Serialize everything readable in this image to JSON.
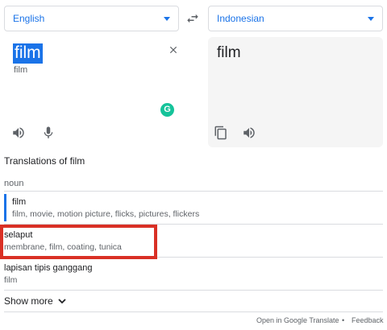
{
  "languages": {
    "source": "English",
    "target": "Indonesian"
  },
  "source": {
    "text": "film",
    "transliteration": "film"
  },
  "target": {
    "text": "film"
  },
  "translations": {
    "title": "Translations of film",
    "pos": "noun",
    "entries": [
      {
        "word": "film",
        "synonyms": "film, movie, motion picture, flicks, pictures, flickers"
      },
      {
        "word": "selaput",
        "synonyms": "membrane, film, coating, tunica"
      },
      {
        "word": "lapisan tipis ganggang",
        "synonyms": "film"
      }
    ]
  },
  "show_more": "Show more",
  "footer": {
    "open": "Open in Google Translate",
    "dot": "•",
    "feedback": "Feedback"
  },
  "colors": {
    "accent": "#1a73e8",
    "highlight": "#d93025",
    "grammarly": "#15c39a"
  }
}
